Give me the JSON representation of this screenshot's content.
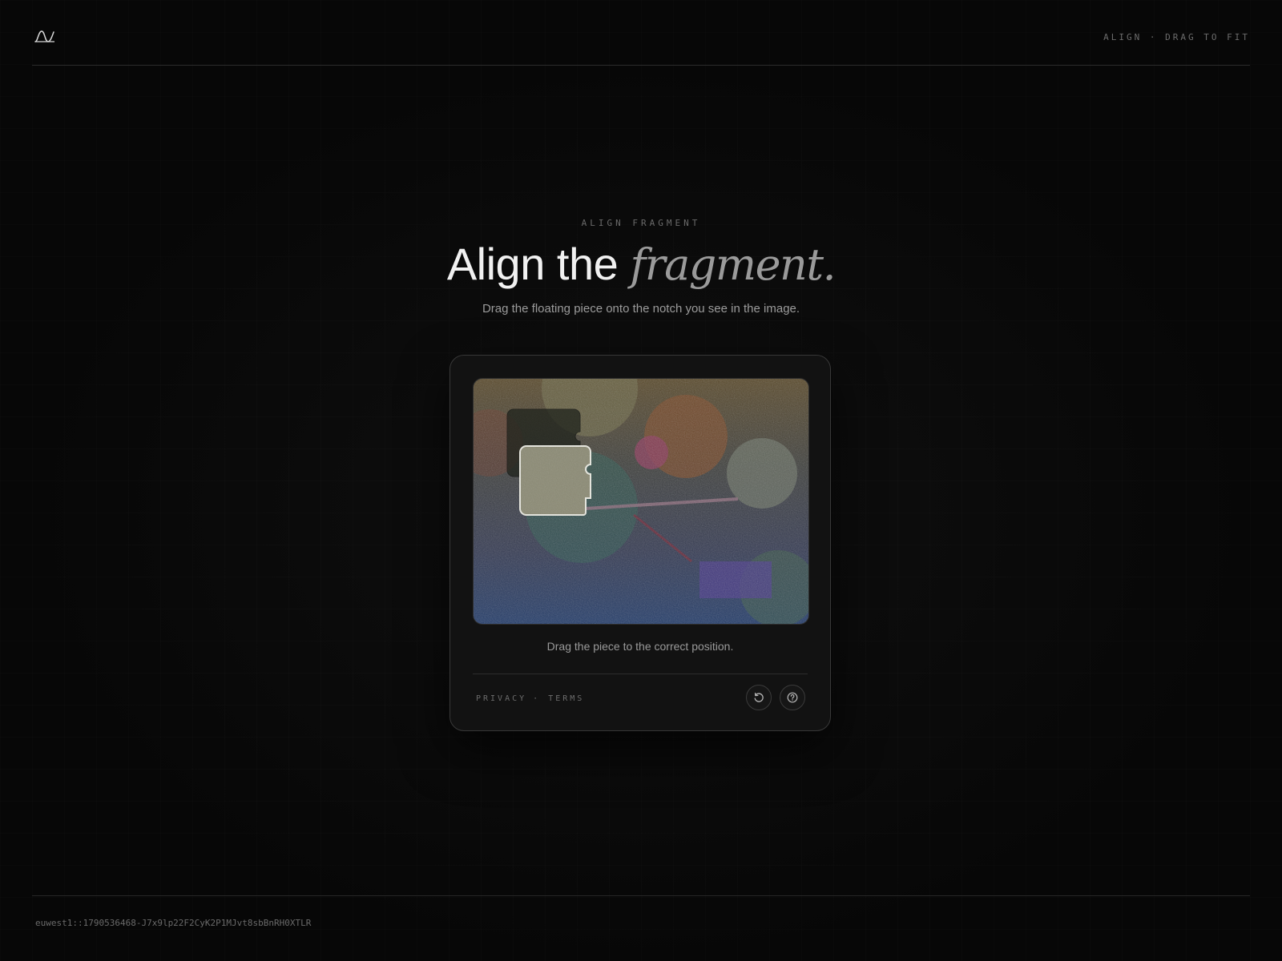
{
  "header": {
    "caption": "ALIGN · DRAG TO FIT"
  },
  "hero": {
    "eyebrow": "ALIGN FRAGMENT",
    "title_main": "Align the ",
    "title_accent": "fragment.",
    "subtitle": "Drag the floating piece onto the notch you see in the image."
  },
  "card": {
    "status": "Drag the piece to the correct position.",
    "links": {
      "privacy": "PRIVACY",
      "separator": "·",
      "terms": "TERMS"
    },
    "buttons": {
      "refresh_icon": "refresh-icon",
      "help_icon": "help-icon"
    }
  },
  "footer": {
    "session_id": "euwest1::1790536468-J7x9lp22F2CyK2P1MJvt8sbBnRH0XTLR"
  }
}
